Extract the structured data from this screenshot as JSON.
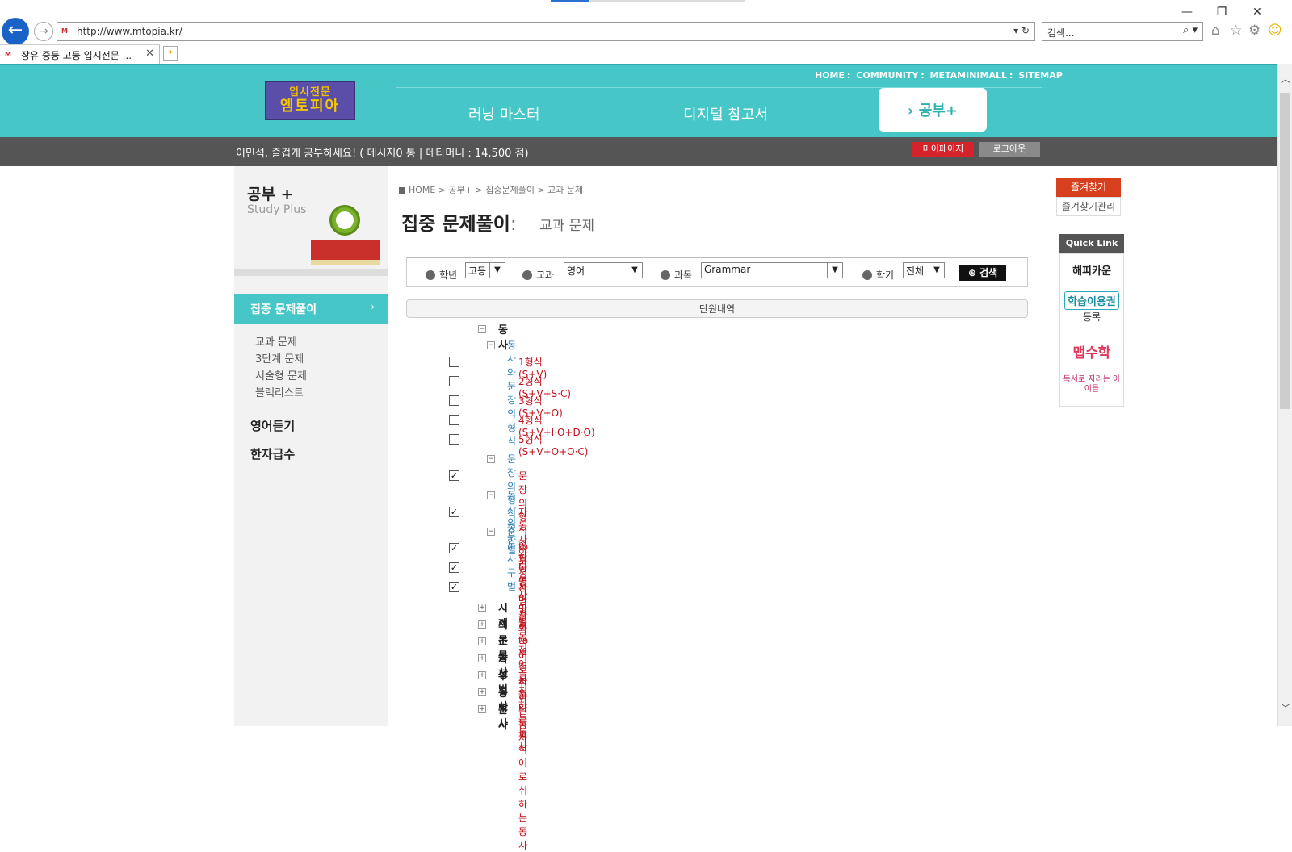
{
  "browser": {
    "url": "http://www.mtopia.kr/",
    "search_placeholder": "검색...",
    "tab_title": "장유 중등 고등 입시전문 ...",
    "window_controls": [
      "minimize-icon",
      "restore-icon",
      "close-icon"
    ]
  },
  "site": {
    "logo_line1": "입시전문",
    "logo_line2": "엠토피아",
    "top_links": [
      "HOME",
      "COMMUNITY",
      "METAMINIMALL",
      "SITEMAP"
    ],
    "nav": [
      "러닝 마스터",
      "디지털 참고서",
      "› 공부+"
    ],
    "user_message": "이민석, 즐겁게 공부하세요! ( 메시지0 통 | 메타머니 : 14,500 점)",
    "mypage_label": "마이페이지",
    "logout_label": "로그아웃"
  },
  "sidebar": {
    "title": "공부 +",
    "subtitle": "Study Plus",
    "active_label": "집중 문제풀이",
    "active_arrow": "›",
    "sub_items": [
      "교과 문제",
      "3단계 문제",
      "서술형 문제",
      "블랙리스트"
    ],
    "main_items": [
      "영어듣기",
      "한자급수"
    ]
  },
  "main": {
    "breadcrumb": "HOME > 공부+ > 집중문제풀이 > 교과 문제",
    "title": "집중 문제풀이",
    "title_suffix": ":",
    "subtitle": "교과 문제",
    "filter": {
      "grade_label": "학년",
      "grade_value": "고등",
      "subject_label": "교과",
      "subject_value": "영어",
      "course_label": "과목",
      "course_value": "Grammar",
      "semester_label": "학기",
      "semester_value": "전체",
      "search_label": "검색"
    },
    "unit_header": "단원내역",
    "tree": {
      "root": "동사",
      "groups": [
        {
          "label": "동사와문장의형식",
          "items": [
            {
              "label": "1형식(S+V)",
              "checked": false
            },
            {
              "label": "2형식(S+V+S·C)",
              "checked": false
            },
            {
              "label": "3형식(S+V+O)",
              "checked": false
            },
            {
              "label": "4형식(S+V+I·O+D·O)",
              "checked": false
            },
            {
              "label": "5형식(S+V+O+O·C)",
              "checked": false
            }
          ]
        },
        {
          "label": "문장의형식종합",
          "items": [
            {
              "label": "문장의형식종합",
              "checked": true
            }
          ]
        },
        {
          "label": "동사의구별",
          "items": [
            {
              "label": "자동사와타동사구별",
              "checked": true
            }
          ]
        },
        {
          "label": "준동사구별",
          "items": [
            {
              "label": "to부정사만을 목적어로 취하는 동사",
              "checked": true
            },
            {
              "label": "동명사만을 목적어로 취하는 동사",
              "checked": true
            },
            {
              "label": "동명사와 to부정사 둘 다를 목적어로 취하는 동사",
              "checked": true
            }
          ]
        }
      ],
      "collapsed": [
        "시제",
        "의문문",
        "조동사",
        "가정법",
        "부정사",
        "동명사",
        "분사"
      ]
    }
  },
  "right": {
    "favorites": "즐겨찾기",
    "favorites_manage": "즐겨찾기관리",
    "quick_link": "Quick Link",
    "happy": "해피카운",
    "study_pass": "학습이용권",
    "study_pass_sub": "등록",
    "math_brand": "맵수학",
    "reading": "독서로 자라는 아이들"
  },
  "colors": {
    "teal": "#46c6c6",
    "dark_bar": "#555555",
    "red": "#d4232b",
    "tree_blue": "#2a7fb8",
    "tree_red": "#c1121c"
  }
}
